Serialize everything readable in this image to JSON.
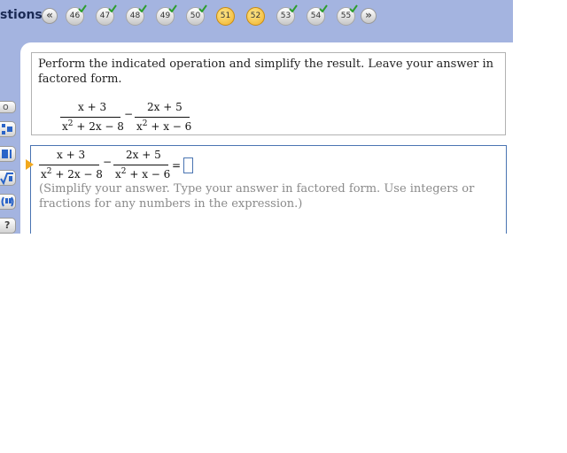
{
  "header": {
    "title_fragment": "stions",
    "nav_prev": "«",
    "nav_next": "»",
    "questions": [
      {
        "label": "46",
        "done": true
      },
      {
        "label": "47",
        "done": true
      },
      {
        "label": "48",
        "done": true
      },
      {
        "label": "49",
        "done": true
      },
      {
        "label": "50",
        "done": true
      },
      {
        "label": "51",
        "done": false
      },
      {
        "label": "52",
        "done": false
      },
      {
        "label": "53",
        "done": true
      },
      {
        "label": "54",
        "done": true
      },
      {
        "label": "55",
        "done": true
      }
    ],
    "current_question": "52"
  },
  "tools": [
    "o",
    "?"
  ],
  "question": {
    "prompt": "Perform the indicated operation and simplify the result. Leave your answer in factored form.",
    "expression": {
      "frac1_num": "x + 3",
      "frac1_den_a": "x",
      "frac1_den_exp": "2",
      "frac1_den_b": " + 2x − 8",
      "operator": "−",
      "frac2_num": "2x + 5",
      "frac2_den_a": "x",
      "frac2_den_exp": "2",
      "frac2_den_b": " + x − 6"
    }
  },
  "answer": {
    "equals": "=",
    "value": "",
    "hint": "(Simplify your answer. Type your answer in factored form. Use integers or fractions for any numbers in the expression.)"
  },
  "colors": {
    "frame": "#a4b4e0",
    "current": "#f0b02a",
    "done_check": "#2e9e2e",
    "answer_border": "#4a74b2"
  }
}
